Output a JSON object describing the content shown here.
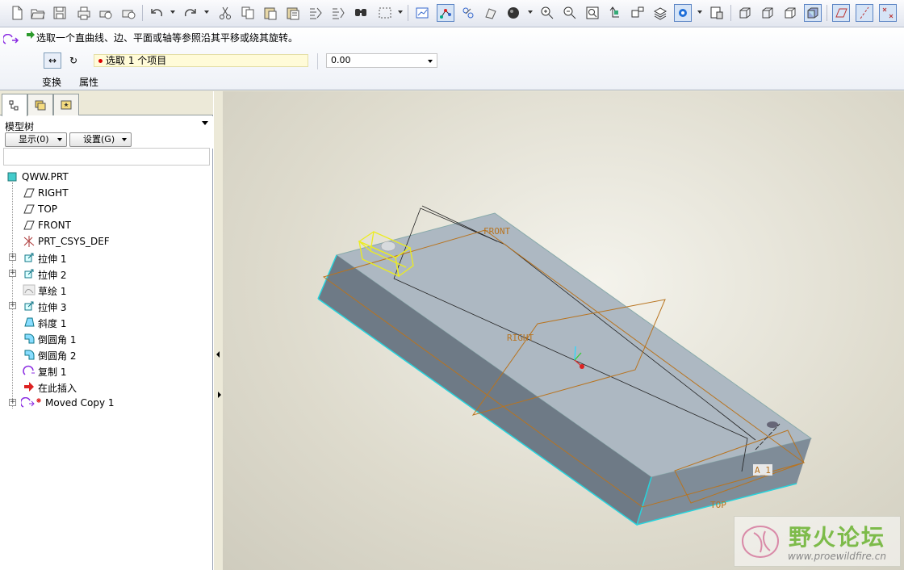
{
  "toolbar": {
    "icons": [
      "new-file",
      "open-file",
      "save",
      "print",
      "print-preview",
      "send-mail",
      "undo",
      "redo",
      "cut",
      "copy",
      "paste",
      "paste-special",
      "regenerate",
      "find",
      "select-box",
      "datum-plane-display",
      "datum-axis-display",
      "datum-point-display",
      "csys-display",
      "shading",
      "zoom-in",
      "zoom-out",
      "refit",
      "reorient",
      "saved-views",
      "layers",
      "spin-center",
      "appearance",
      "view-wireframe",
      "view-hidden-line",
      "view-no-hidden",
      "view-shading",
      "plane-display",
      "axis-display",
      "point-display"
    ]
  },
  "dashboard": {
    "message": "选取一个直曲线、边、平面或轴等参照沿其平移或绕其旋转。",
    "translate_symbol": "↔",
    "rotate_symbol": "↻",
    "collector_text": "选取 1 个项目",
    "value": "0.00",
    "tabs": [
      "变换",
      "属性"
    ]
  },
  "panel": {
    "tree_title": "模型树",
    "show_button": "显示(0)",
    "settings_button": "设置(G)"
  },
  "tree": {
    "items": [
      {
        "label": "QWW.PRT",
        "icon": "part-icon"
      },
      {
        "label": "RIGHT",
        "icon": "datum-plane-icon"
      },
      {
        "label": "TOP",
        "icon": "datum-plane-icon"
      },
      {
        "label": "FRONT",
        "icon": "datum-plane-icon"
      },
      {
        "label": "PRT_CSYS_DEF",
        "icon": "csys-icon"
      },
      {
        "label": "拉伸 1",
        "icon": "extrude-icon"
      },
      {
        "label": "拉伸 2",
        "icon": "extrude-icon"
      },
      {
        "label": "草绘 1",
        "icon": "sketch-icon"
      },
      {
        "label": "拉伸 3",
        "icon": "extrude-icon"
      },
      {
        "label": "斜度 1",
        "icon": "draft-icon"
      },
      {
        "label": "倒圆角 1",
        "icon": "round-icon"
      },
      {
        "label": "倒圆角 2",
        "icon": "round-icon"
      },
      {
        "label": "复制 1",
        "icon": "copy-icon"
      },
      {
        "label": "在此插入",
        "icon": "insert-here-icon"
      },
      {
        "label": "Moved Copy 1",
        "icon": "moved-copy-icon"
      }
    ]
  },
  "model": {
    "datum_labels": {
      "front": "FRONT",
      "right": "RIGHT",
      "top": "TOP",
      "axis": "A_1"
    }
  },
  "watermark": {
    "title": "野火论坛",
    "url": "www.proewildfire.cn"
  }
}
